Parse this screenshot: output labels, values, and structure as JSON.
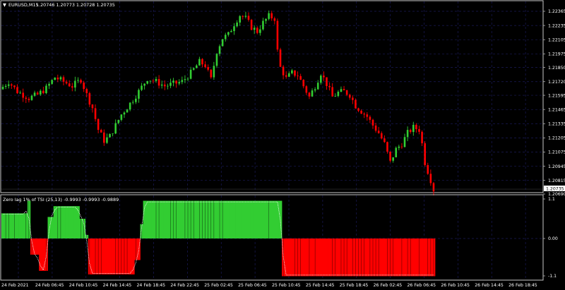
{
  "window": {
    "symbol_title": "EURUSD,M15",
    "ohlc_values": "1.20746 1.20773 1.20728 1.20735"
  },
  "indicator": {
    "title": "Zero lag 1% of TSI (25,13) -0.9993 -0.9993 -0.9889"
  },
  "colors": {
    "background": "#000000",
    "grid": "#1b1b5a",
    "frame": "#c8c8c8",
    "bull_candle": "#32cd32",
    "bear_candle": "#ff0000",
    "hist_up": "#32cd32",
    "hist_down": "#ff0000",
    "signal_line": "#ffffff",
    "price_tag_bg": "#ffffff",
    "price_tag_text": "#000000"
  },
  "price_axis": {
    "labels": [
      "1.22365",
      "1.22235",
      "1.22105",
      "1.21975",
      "1.21850",
      "1.21720",
      "1.21595",
      "1.21465",
      "1.21335",
      "1.21205",
      "1.21075",
      "1.20945",
      "1.20815",
      "1.20690"
    ],
    "current_price": "1.20735"
  },
  "indicator_axis": {
    "labels": [
      "1.1",
      "0.00",
      "-1.1"
    ]
  },
  "time_axis": {
    "labels": [
      "24 Feb 2021",
      "24 Feb 06:45",
      "24 Feb 10:45",
      "24 Feb 14:45",
      "24 Feb 18:45",
      "24 Feb 22:45",
      "25 Feb 02:45",
      "25 Feb 06:45",
      "25 Feb 10:45",
      "25 Feb 14:45",
      "25 Feb 18:45",
      "26 Feb 02:45",
      "26 Feb 06:45",
      "26 Feb 10:45",
      "26 Feb 14:45",
      "26 Feb 18:45"
    ]
  },
  "chart_data": {
    "type": "candlestick",
    "symbol": "EURUSD",
    "timeframe": "M15",
    "x_range": [
      "24 Feb 2021",
      "26 Feb 18:45"
    ],
    "price_path": [
      [
        0,
        1.2165
      ],
      [
        3,
        1.2172
      ],
      [
        6,
        1.2163
      ],
      [
        10,
        1.2157
      ],
      [
        13,
        1.216
      ],
      [
        16,
        1.2166
      ],
      [
        19,
        1.2176
      ],
      [
        22,
        1.2172
      ],
      [
        25,
        1.2168
      ],
      [
        28,
        1.2174
      ],
      [
        30,
        1.216
      ],
      [
        32,
        1.2148
      ],
      [
        34,
        1.2128
      ],
      [
        36,
        1.2118
      ],
      [
        38,
        1.2122
      ],
      [
        40,
        1.2132
      ],
      [
        42,
        1.2142
      ],
      [
        45,
        1.2152
      ],
      [
        48,
        1.2163
      ],
      [
        51,
        1.2175
      ],
      [
        54,
        1.2172
      ],
      [
        57,
        1.2168
      ],
      [
        60,
        1.217
      ],
      [
        63,
        1.2172
      ],
      [
        66,
        1.218
      ],
      [
        69,
        1.219
      ],
      [
        71,
        1.2187
      ],
      [
        73,
        1.2174
      ],
      [
        75,
        1.22
      ],
      [
        77,
        1.2212
      ],
      [
        79,
        1.2215
      ],
      [
        81,
        1.2225
      ],
      [
        83,
        1.2233
      ],
      [
        85,
        1.223
      ],
      [
        87,
        1.2222
      ],
      [
        89,
        1.2218
      ],
      [
        91,
        1.2226
      ],
      [
        93,
        1.2232
      ],
      [
        95,
        1.223
      ],
      [
        96,
        1.22
      ],
      [
        97,
        1.2185
      ],
      [
        99,
        1.2175
      ],
      [
        101,
        1.218
      ],
      [
        103,
        1.2178
      ],
      [
        105,
        1.2168
      ],
      [
        107,
        1.2158
      ],
      [
        109,
        1.2168
      ],
      [
        111,
        1.218
      ],
      [
        113,
        1.217
      ],
      [
        115,
        1.2158
      ],
      [
        117,
        1.2162
      ],
      [
        119,
        1.2163
      ],
      [
        121,
        1.216
      ],
      [
        123,
        1.215
      ],
      [
        125,
        1.2145
      ],
      [
        127,
        1.214
      ],
      [
        129,
        1.2132
      ],
      [
        131,
        1.2125
      ],
      [
        133,
        1.2115
      ],
      [
        135,
        1.2098
      ],
      [
        137,
        1.211
      ],
      [
        139,
        1.2115
      ],
      [
        141,
        1.2125
      ],
      [
        143,
        1.213
      ],
      [
        145,
        1.2128
      ],
      [
        146,
        1.2115
      ],
      [
        147,
        1.2098
      ],
      [
        148,
        1.209
      ],
      [
        149,
        1.2082
      ],
      [
        150,
        1.2073
      ]
    ],
    "indicator": {
      "name": "Zero lag 1% of TSI",
      "params": "25,13",
      "ylim": [
        -1.1,
        1.1
      ],
      "histogram_segments": [
        {
          "from": 0,
          "to": 9,
          "value": 0.7
        },
        {
          "from": 9,
          "to": 10,
          "value": 1.05
        },
        {
          "from": 10,
          "to": 13,
          "value": -0.45
        },
        {
          "from": 13,
          "to": 16,
          "value": -0.9
        },
        {
          "from": 16,
          "to": 18,
          "value": 0.6
        },
        {
          "from": 18,
          "to": 27,
          "value": 0.9
        },
        {
          "from": 27,
          "to": 29,
          "value": 0.55
        },
        {
          "from": 29,
          "to": 30,
          "value": 0.1
        },
        {
          "from": 30,
          "to": 46,
          "value": -1.0
        },
        {
          "from": 46,
          "to": 48,
          "value": -0.6
        },
        {
          "from": 48,
          "to": 49,
          "value": 0.4
        },
        {
          "from": 49,
          "to": 97,
          "value": 1.05
        },
        {
          "from": 97,
          "to": 150,
          "value": -1.05
        }
      ]
    }
  }
}
